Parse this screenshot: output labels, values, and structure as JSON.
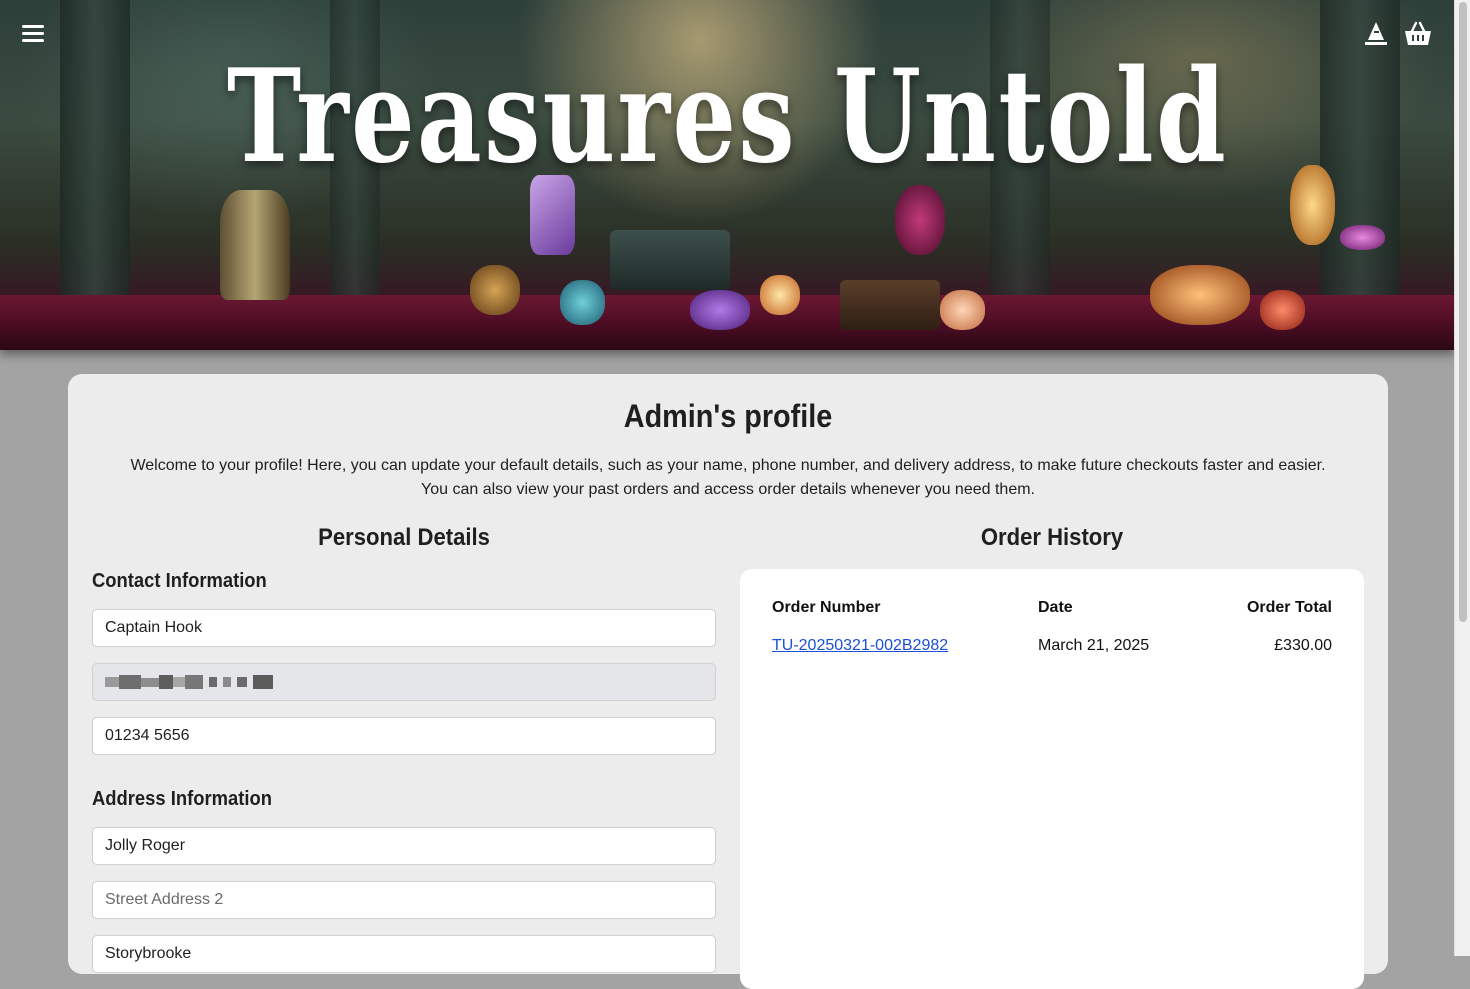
{
  "header": {
    "site_title": "Treasures Untold",
    "menu_icon": "hamburger-menu-icon",
    "account_icon": "wizard-hat-icon",
    "basket_icon": "shopping-basket-icon"
  },
  "profile": {
    "title": "Admin's profile",
    "intro_line1": "Welcome to your profile! Here, you can update your default details, such as your name, phone number, and delivery address, to make future checkouts faster and easier.",
    "intro_line2": "You can also view your past orders and access order details whenever you need them."
  },
  "personal_details": {
    "heading": "Personal Details",
    "contact_heading": "Contact Information",
    "name_value": "Captain Hook",
    "email_value": "",
    "phone_value": "01234 5656",
    "address_heading": "Address Information",
    "street1_value": "Jolly Roger",
    "street2_placeholder": "Street Address 2",
    "town_value": "Storybrooke"
  },
  "order_history": {
    "heading": "Order History",
    "columns": [
      "Order Number",
      "Date",
      "Order Total"
    ],
    "rows": [
      {
        "number": "TU-20250321-002B2982",
        "date": "March 21, 2025",
        "total": "£330.00"
      }
    ]
  },
  "colors": {
    "page_bg": "#a3a3a3",
    "card_bg": "#ececec",
    "link": "#1a4fd6"
  }
}
